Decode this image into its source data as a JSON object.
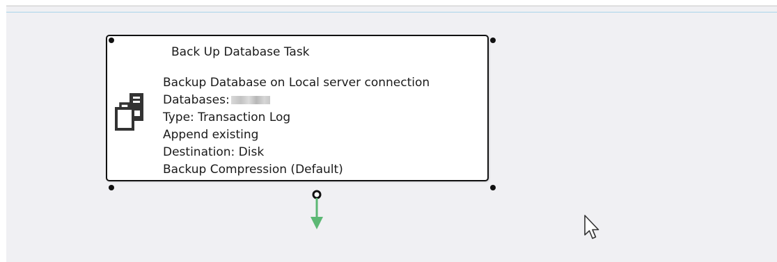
{
  "task": {
    "title": "Back Up Database Task",
    "detail_connection": "Backup Database on Local server connection",
    "detail_databases_label": "Databases:",
    "detail_type": "Type: Transaction Log",
    "detail_append": "Append existing",
    "detail_destination": "Destination: Disk",
    "detail_compression": "Backup Compression (Default)",
    "icon": "backup-database-task-icon"
  },
  "precedence_constraint": {
    "color": "#5cb874",
    "type": "success"
  },
  "colors": {
    "surface": "#f0f0f3",
    "task_border": "#111111",
    "accent_line": "#a9d5ea"
  }
}
